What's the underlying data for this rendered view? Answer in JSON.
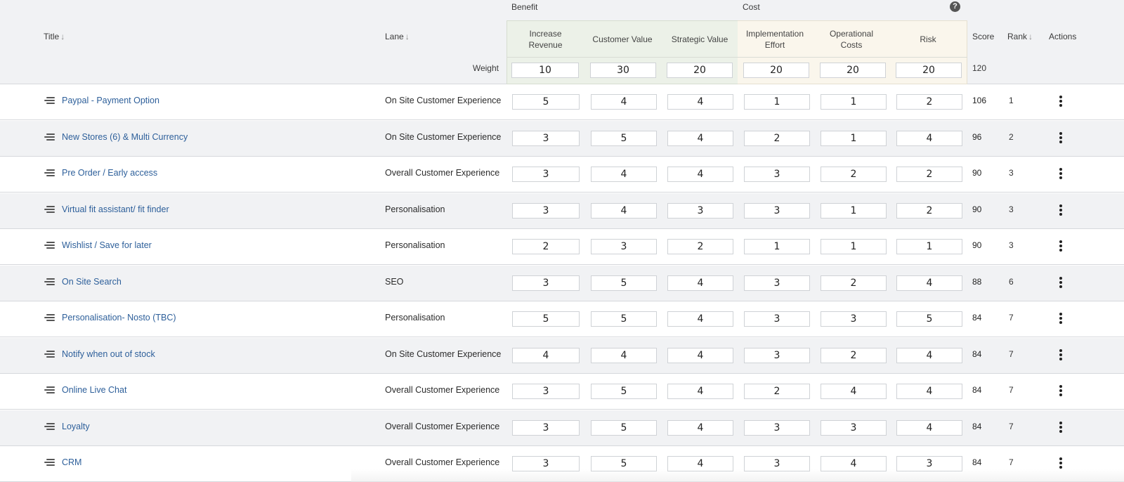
{
  "groups": {
    "benefit": "Benefit",
    "cost": "Cost"
  },
  "help_icon": "question-circle-icon",
  "columns": {
    "title": "Title",
    "lane": "Lane",
    "score": "Score",
    "rank": "Rank",
    "actions": "Actions",
    "sort_glyph": "↓"
  },
  "criteria": [
    {
      "label": "Increase Revenue",
      "group": "benefit",
      "weight": "10"
    },
    {
      "label": "Customer Value",
      "group": "benefit",
      "weight": "30"
    },
    {
      "label": "Strategic Value",
      "group": "benefit",
      "weight": "20"
    },
    {
      "label": "Implementation Effort",
      "group": "cost",
      "weight": "20"
    },
    {
      "label": "Operational Costs",
      "group": "cost",
      "weight": "20"
    },
    {
      "label": "Risk",
      "group": "cost",
      "weight": "20"
    }
  ],
  "weight_row": {
    "label": "Weight",
    "total": "120"
  },
  "colors": {
    "benefit_bg": "#ecf1e8",
    "cost_bg": "#faf6ec",
    "link": "#2d5f9a",
    "row_alt": "#f1f2f4"
  },
  "rows": [
    {
      "title": "Paypal - Payment Option",
      "lane": "On Site Customer Experience",
      "values": [
        "5",
        "4",
        "4",
        "1",
        "1",
        "2"
      ],
      "score": "106",
      "rank": "1"
    },
    {
      "title": "New Stores (6) & Multi Currency",
      "lane": "On Site Customer Experience",
      "values": [
        "3",
        "5",
        "4",
        "2",
        "1",
        "4"
      ],
      "score": "96",
      "rank": "2"
    },
    {
      "title": "Pre Order / Early access",
      "lane": "Overall Customer Experience",
      "values": [
        "3",
        "4",
        "4",
        "3",
        "2",
        "2"
      ],
      "score": "90",
      "rank": "3"
    },
    {
      "title": "Virtual fit assistant/ fit finder",
      "lane": "Personalisation",
      "values": [
        "3",
        "4",
        "3",
        "3",
        "1",
        "2"
      ],
      "score": "90",
      "rank": "3"
    },
    {
      "title": "Wishlist / Save for later",
      "lane": "Personalisation",
      "values": [
        "2",
        "3",
        "2",
        "1",
        "1",
        "1"
      ],
      "score": "90",
      "rank": "3"
    },
    {
      "title": "On Site Search",
      "lane": "SEO",
      "values": [
        "3",
        "5",
        "4",
        "3",
        "2",
        "4"
      ],
      "score": "88",
      "rank": "6"
    },
    {
      "title": "Personalisation- Nosto (TBC)",
      "lane": "Personalisation",
      "values": [
        "5",
        "5",
        "4",
        "3",
        "3",
        "5"
      ],
      "score": "84",
      "rank": "7"
    },
    {
      "title": "Notify when out of stock",
      "lane": "On Site Customer Experience",
      "values": [
        "4",
        "4",
        "4",
        "3",
        "2",
        "4"
      ],
      "score": "84",
      "rank": "7"
    },
    {
      "title": "Online Live Chat",
      "lane": "Overall Customer Experience",
      "values": [
        "3",
        "5",
        "4",
        "2",
        "4",
        "4"
      ],
      "score": "84",
      "rank": "7"
    },
    {
      "title": "Loyalty",
      "lane": "Overall Customer Experience",
      "values": [
        "3",
        "5",
        "4",
        "3",
        "3",
        "4"
      ],
      "score": "84",
      "rank": "7"
    },
    {
      "title": "CRM",
      "lane": "Overall Customer Experience",
      "values": [
        "3",
        "5",
        "4",
        "3",
        "4",
        "3"
      ],
      "score": "84",
      "rank": "7"
    }
  ]
}
